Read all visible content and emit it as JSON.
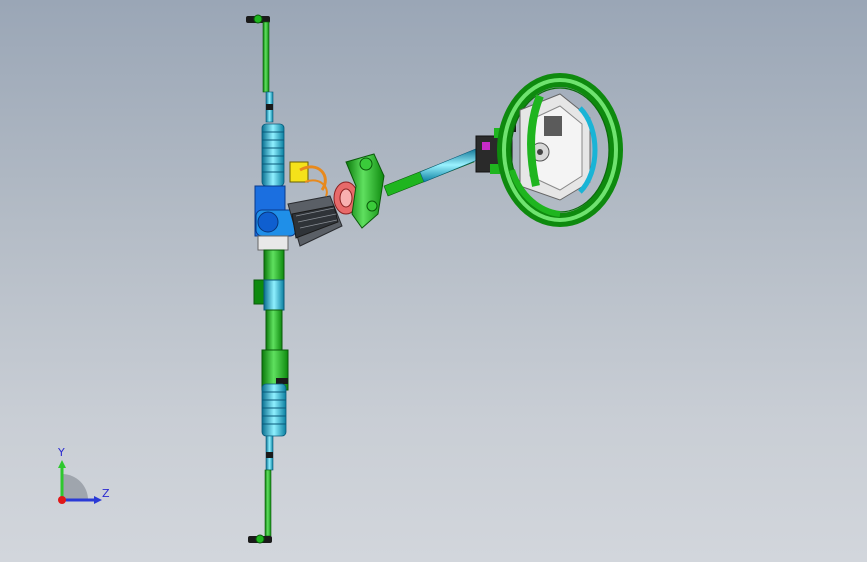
{
  "viewport": {
    "background_top": "#9aa6b6",
    "background_bottom": "#d2d6dc"
  },
  "colors": {
    "green_dark": "#0e8a0e",
    "green_mid": "#1fb51f",
    "green_light": "#6fe36f",
    "cyan_dark": "#0a7fa0",
    "cyan_mid": "#19b4d6",
    "cyan_light": "#7ee6f6",
    "blue": "#1b6fe0",
    "yellow": "#f4e21a",
    "orange": "#e8891c",
    "salmon": "#e86a6a",
    "gray_dark": "#555a60",
    "white": "#f2f2f2",
    "magenta": "#c62bc6"
  },
  "triad": {
    "y_label": "Y",
    "z_label": "Z",
    "y_color": "#2ec82e",
    "z_color": "#2a3ad6",
    "origin_color": "#e01818"
  }
}
